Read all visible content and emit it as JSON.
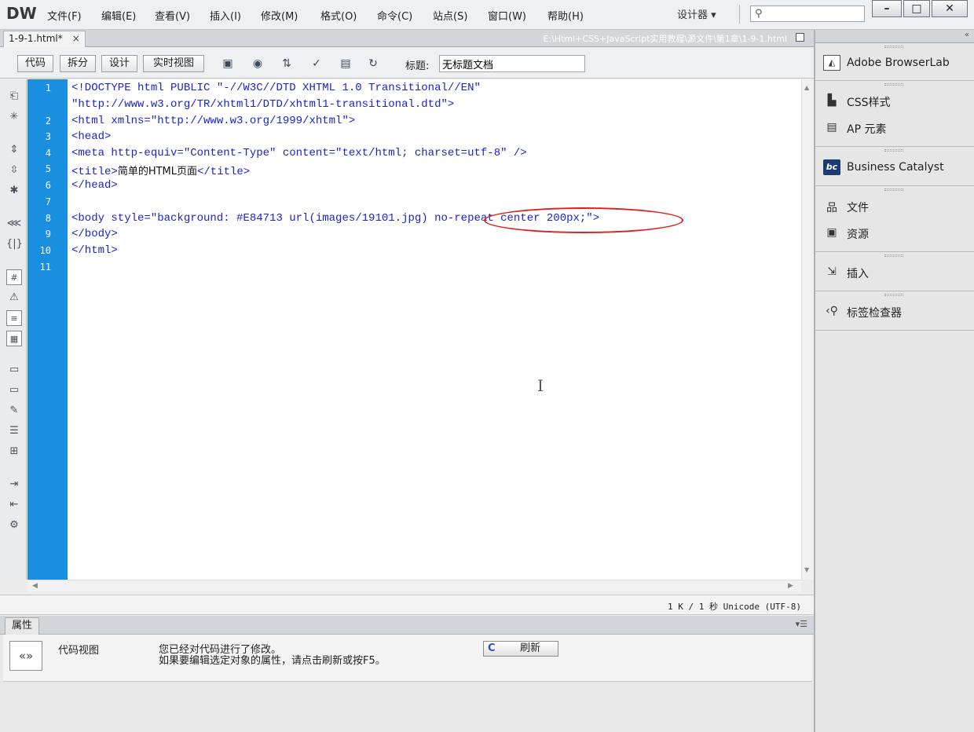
{
  "app": {
    "logo": "DW",
    "menus": [
      {
        "label": "文件(F)"
      },
      {
        "label": "编辑(E)"
      },
      {
        "label": "查看(V)"
      },
      {
        "label": "插入(I)"
      },
      {
        "label": "修改(M)"
      },
      {
        "label": "格式(O)"
      },
      {
        "label": "命令(C)"
      },
      {
        "label": "站点(S)"
      },
      {
        "label": "窗口(W)"
      },
      {
        "label": "帮助(H)"
      }
    ],
    "workspace_switcher": "设计器 ▾",
    "search": {
      "placeholder": "",
      "icon": "search-icon"
    },
    "window_controls": {
      "minimize": "–",
      "maximize": "□",
      "close": "✕"
    }
  },
  "document": {
    "tab_label": "1-9-1.html*",
    "tab_close": "×",
    "path": "E:\\Html+CSS+JavaScript实用教程\\源文件\\第1章\\1-9-1.html"
  },
  "toolbar": {
    "view_buttons": [
      {
        "label": "代码"
      },
      {
        "label": "拆分"
      },
      {
        "label": "设计"
      },
      {
        "label": "实时视图"
      }
    ],
    "title_label": "标题:",
    "title_value": "无标题文档"
  },
  "code": {
    "lines": [
      {
        "no": "1",
        "text": "<!DOCTYPE html PUBLIC \"-//W3C//DTD XHTML 1.0 Transitional//EN\""
      },
      {
        "no": "",
        "text": "\"http://www.w3.org/TR/xhtml1/DTD/xhtml1-transitional.dtd\">"
      },
      {
        "no": "2",
        "text": "<html xmlns=\"http://www.w3.org/1999/xhtml\">"
      },
      {
        "no": "3",
        "text": "<head>"
      },
      {
        "no": "4",
        "text": "<meta http-equiv=\"Content-Type\" content=\"text/html; charset=utf-8\" />"
      },
      {
        "no": "5",
        "pre": "<title>",
        "mid": "简单的HTML页面",
        "post": "</title>"
      },
      {
        "no": "6",
        "text": "</head>"
      },
      {
        "no": "7",
        "text": ""
      },
      {
        "no": "8",
        "text": "<body style=\"background: #E84713 url(images/19101.jpg) no-repeat center 200px;\">"
      },
      {
        "no": "9",
        "text": "</body>"
      },
      {
        "no": "10",
        "text": "</html>"
      },
      {
        "no": "11",
        "text": ""
      }
    ]
  },
  "status": {
    "text": "1 K / 1 秒 Unicode (UTF-8)"
  },
  "properties": {
    "tab_label": "属性",
    "code_view_icon": "«»",
    "code_view_label": "代码视图",
    "message_line1": "您已经对代码进行了修改。",
    "message_line2": "如果要编辑选定对象的属性，请点击刷新或按F5。",
    "refresh_label": "刷新"
  },
  "panels": [
    {
      "label": "Adobe BrowserLab",
      "icon": "browserlab-icon"
    },
    {
      "label": "CSS样式",
      "icon": "css-styles-icon"
    },
    {
      "label": "AP 元素",
      "icon": "ap-elements-icon"
    },
    {
      "label": "Business Catalyst",
      "icon": "business-catalyst-icon"
    },
    {
      "label": "文件",
      "icon": "files-icon"
    },
    {
      "label": "资源",
      "icon": "assets-icon"
    },
    {
      "label": "插入",
      "icon": "insert-icon"
    },
    {
      "label": "标签检查器",
      "icon": "tag-inspector-icon"
    }
  ],
  "colors": {
    "gutter": "#1a8fe0",
    "code_text": "#1a24c8",
    "annotation": "#e02020"
  }
}
